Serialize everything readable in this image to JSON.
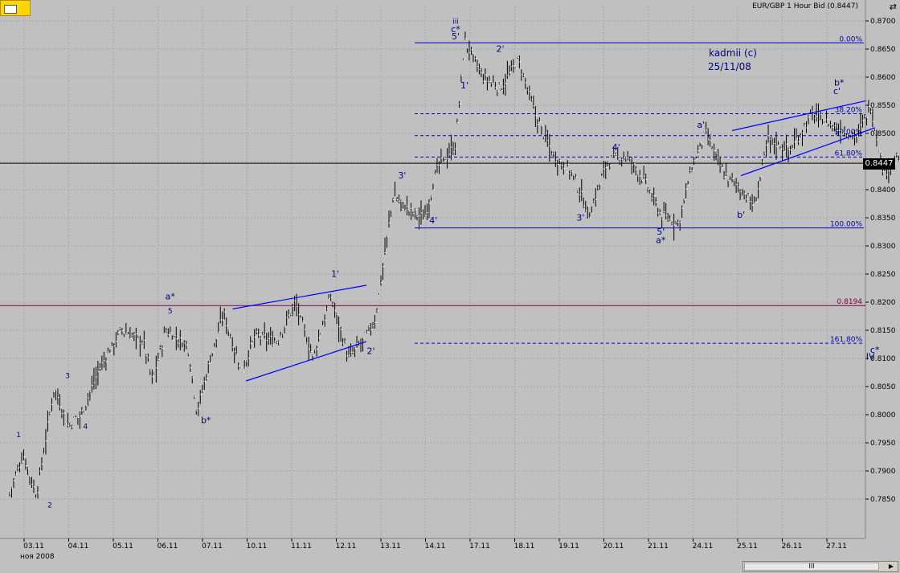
{
  "toolbar": {
    "icon_name": "grid-toggle-icon"
  },
  "header": {
    "title": "EUR/GBP 1 Hour Bid (0.8447)",
    "corner_icon": "expand-arrows-icon",
    "corner_glyph": "⇄"
  },
  "price_tag": "0.8447",
  "colors": {
    "background": "#c0c0c0",
    "grid": "#a8a8a8",
    "bars": "#000000",
    "trendline": "#0000ff",
    "fib": "#0000c0",
    "magenta_line": "#800040",
    "current_line": "#000000",
    "label": "#000080"
  },
  "annotation": {
    "author": "kadmii (c)",
    "date": "25/11/08"
  },
  "scrollbar": {
    "thumb_glyph": "III",
    "arrow_glyph": "▶"
  },
  "chart_data": {
    "type": "ohlc",
    "instrument": "EUR/GBP",
    "timeframe": "1 Hour Bid",
    "last_price": 0.8447,
    "ylim": [
      0.78,
      0.87
    ],
    "yticks": [
      "0.8700",
      "0.8650",
      "0.8600",
      "0.8550",
      "0.8500",
      "0.8450",
      "0.8400",
      "0.8350",
      "0.8300",
      "0.8250",
      "0.8200",
      "0.8150",
      "0.8100",
      "0.8050",
      "0.8000",
      "0.7950",
      "0.7900",
      "0.7850"
    ],
    "xticks": [
      "03.11",
      "04.11",
      "05.11",
      "06.11",
      "07.11",
      "10.11",
      "11.11",
      "12.11",
      "13.11",
      "14.11",
      "17.11",
      "18.11",
      "19.11",
      "20.11",
      "21.11",
      "24.11",
      "25.11",
      "26.11",
      "27.11"
    ],
    "month_label": "ноя 2008",
    "grid": true,
    "fib_levels": [
      {
        "label": "0.00%",
        "value": 0.8661,
        "style": "solid"
      },
      {
        "label": "38.20%",
        "value": 0.8535,
        "style": "dashed"
      },
      {
        "label": "50.00%",
        "value": 0.8496,
        "style": "dashed"
      },
      {
        "label": "61.80%",
        "value": 0.8458,
        "style": "dashed"
      },
      {
        "label": "100.00%",
        "value": 0.8332,
        "style": "solid"
      },
      {
        "label": "161.80%",
        "value": 0.8127,
        "style": "dashed"
      }
    ],
    "magenta_level": {
      "label": "0.8194",
      "value": 0.8194
    },
    "price_path": [
      [
        0,
        0.786
      ],
      [
        0.3,
        0.793
      ],
      [
        0.6,
        0.7855
      ],
      [
        1.0,
        0.805
      ],
      [
        1.3,
        0.798
      ],
      [
        1.6,
        0.8
      ],
      [
        2.0,
        0.808
      ],
      [
        2.5,
        0.815
      ],
      [
        3.0,
        0.813
      ],
      [
        3.2,
        0.806
      ],
      [
        3.5,
        0.815
      ],
      [
        4.0,
        0.812
      ],
      [
        4.2,
        0.8005
      ],
      [
        4.5,
        0.81
      ],
      [
        4.8,
        0.818
      ],
      [
        5.2,
        0.8075
      ],
      [
        5.5,
        0.814
      ],
      [
        6.0,
        0.813
      ],
      [
        6.4,
        0.82
      ],
      [
        6.8,
        0.81
      ],
      [
        7.2,
        0.821
      ],
      [
        7.6,
        0.81
      ],
      [
        8.0,
        0.814
      ],
      [
        8.2,
        0.817
      ],
      [
        8.6,
        0.839
      ],
      [
        9.0,
        0.836
      ],
      [
        9.3,
        0.835
      ],
      [
        9.6,
        0.844
      ],
      [
        10.0,
        0.848
      ],
      [
        10.2,
        0.8665
      ],
      [
        10.6,
        0.86
      ],
      [
        11.0,
        0.858
      ],
      [
        11.4,
        0.863
      ],
      [
        11.8,
        0.853
      ],
      [
        12.2,
        0.846
      ],
      [
        12.6,
        0.843
      ],
      [
        13.0,
        0.8355
      ],
      [
        13.4,
        0.845
      ],
      [
        13.8,
        0.846
      ],
      [
        14.2,
        0.842
      ],
      [
        14.6,
        0.8355
      ],
      [
        15.0,
        0.834
      ],
      [
        15.3,
        0.844
      ],
      [
        15.6,
        0.85
      ],
      [
        16.0,
        0.843
      ],
      [
        16.4,
        0.84
      ],
      [
        16.7,
        0.837
      ],
      [
        17.0,
        0.849
      ],
      [
        17.5,
        0.847
      ],
      [
        18.0,
        0.8535
      ],
      [
        18.5,
        0.851
      ],
      [
        19.0,
        0.8495
      ],
      [
        19.3,
        0.855
      ],
      [
        19.6,
        0.843
      ],
      [
        19.9,
        0.8455
      ],
      [
        20.2,
        0.844
      ]
    ],
    "trendlines": [
      {
        "from": [
          5.0,
          0.8188
        ],
        "to": [
          8.0,
          0.823
        ]
      },
      {
        "from": [
          5.3,
          0.806
        ],
        "to": [
          8.0,
          0.813
        ]
      },
      {
        "from": [
          16.2,
          0.8505
        ],
        "to": [
          19.2,
          0.8558
        ]
      },
      {
        "from": [
          16.4,
          0.8425
        ],
        "to": [
          19.4,
          0.851
        ]
      }
    ],
    "wave_labels": [
      {
        "text": "1",
        "x": 0.2,
        "y": 0.796
      },
      {
        "text": "2",
        "x": 0.9,
        "y": 0.7835
      },
      {
        "text": "3",
        "x": 1.3,
        "y": 0.8065
      },
      {
        "text": "4",
        "x": 1.7,
        "y": 0.7975
      },
      {
        "text": "a*",
        "x": 3.6,
        "y": 0.8205
      },
      {
        "text": "5",
        "x": 3.6,
        "y": 0.818
      },
      {
        "text": "b*",
        "x": 4.4,
        "y": 0.7985
      },
      {
        "text": "1'",
        "x": 7.3,
        "y": 0.8245
      },
      {
        "text": "2'",
        "x": 8.1,
        "y": 0.8108
      },
      {
        "text": "3'",
        "x": 8.8,
        "y": 0.842
      },
      {
        "text": "4'",
        "x": 9.5,
        "y": 0.834
      },
      {
        "text": "iii",
        "x": 10.0,
        "y": 0.8695
      },
      {
        "text": "c*",
        "x": 10.0,
        "y": 0.868
      },
      {
        "text": "5'",
        "x": 10.0,
        "y": 0.8667
      },
      {
        "text": "1'",
        "x": 10.2,
        "y": 0.858
      },
      {
        "text": "2'",
        "x": 11.0,
        "y": 0.8645
      },
      {
        "text": "3'",
        "x": 12.8,
        "y": 0.8345
      },
      {
        "text": "4'",
        "x": 13.6,
        "y": 0.847
      },
      {
        "text": "5'",
        "x": 14.6,
        "y": 0.832
      },
      {
        "text": "a*",
        "x": 14.6,
        "y": 0.8305
      },
      {
        "text": "a'",
        "x": 15.5,
        "y": 0.851
      },
      {
        "text": "b'",
        "x": 16.4,
        "y": 0.835
      },
      {
        "text": "b*",
        "x": 18.6,
        "y": 0.8585
      },
      {
        "text": "c'",
        "x": 18.55,
        "y": 0.857
      },
      {
        "text": "c*",
        "x": 19.4,
        "y": 0.811
      },
      {
        "text": "IV",
        "x": 19.3,
        "y": 0.8098
      }
    ]
  }
}
